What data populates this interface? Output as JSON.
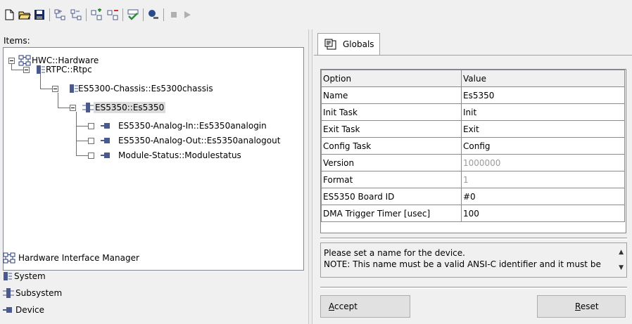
{
  "toolbar": {
    "buttons": [
      {
        "icon": "new-document-icon"
      },
      {
        "icon": "open-folder-icon"
      },
      {
        "icon": "save-disk-icon"
      },
      {
        "icon": "add-hierarchy-icon"
      },
      {
        "icon": "remove-hierarchy-icon"
      },
      {
        "icon": "add-module-icon"
      },
      {
        "icon": "remove-module-icon"
      },
      {
        "icon": "check-build-icon"
      },
      {
        "icon": "connect-icon"
      },
      {
        "icon": "stop-icon"
      },
      {
        "icon": "run-icon"
      }
    ]
  },
  "items_label": "Items:",
  "tree": [
    {
      "label": "HWC::Hardware",
      "type": "hardware",
      "expanded": true
    },
    {
      "label": "RTPC::Rtpc",
      "type": "system",
      "expanded": true
    },
    {
      "label": "ES5300-Chassis::Es5300chassis",
      "type": "system",
      "expanded": true
    },
    {
      "label": "ES5350::Es5350",
      "type": "subsystem",
      "expanded": true,
      "selected": true
    },
    {
      "label": "ES5350-Analog-In::Es5350analogin",
      "type": "device",
      "checked": false
    },
    {
      "label": "ES5350-Analog-Out::Es5350analogout",
      "type": "device",
      "checked": false
    },
    {
      "label": "Module-Status::Modulestatus",
      "type": "device",
      "checked": false
    }
  ],
  "legend": [
    {
      "label": "Hardware Interface Manager",
      "icon": "hardware-interface-manager-icon"
    },
    {
      "label": "System",
      "icon": "system-icon"
    },
    {
      "label": "Subsystem",
      "icon": "subsystem-icon"
    },
    {
      "label": "Device",
      "icon": "device-icon"
    }
  ],
  "tabs": [
    {
      "label": "Globals",
      "icon": "properties-sheet-icon",
      "active": true
    }
  ],
  "grid": {
    "headers": [
      "Option",
      "Value"
    ],
    "rows": [
      {
        "option": "Name",
        "value": "Es5350",
        "readonly": false
      },
      {
        "option": "Init Task",
        "value": "Init",
        "readonly": false
      },
      {
        "option": "Exit Task",
        "value": "Exit",
        "readonly": false
      },
      {
        "option": "Config Task",
        "value": "Config",
        "readonly": false
      },
      {
        "option": "Version",
        "value": "1000000",
        "readonly": true
      },
      {
        "option": "Format",
        "value": "1",
        "readonly": true
      },
      {
        "option": "ES5350 Board ID",
        "value": "#0",
        "readonly": false
      },
      {
        "option": "DMA Trigger Timer [usec]",
        "value": "100",
        "readonly": false
      }
    ]
  },
  "description": {
    "line1": "Please set a name for the device.",
    "line2": "NOTE: This name must be a valid ANSI-C identifier and it must be"
  },
  "buttons": {
    "accept": "Accept",
    "reset": "Reset"
  },
  "colors": {
    "readonly_text": "#9a9a9a",
    "selection": "#dcdcdc",
    "icon_dark": "#4a5a8c",
    "icon_check": "#2e8b3a",
    "icon_remove": "#d03030"
  }
}
